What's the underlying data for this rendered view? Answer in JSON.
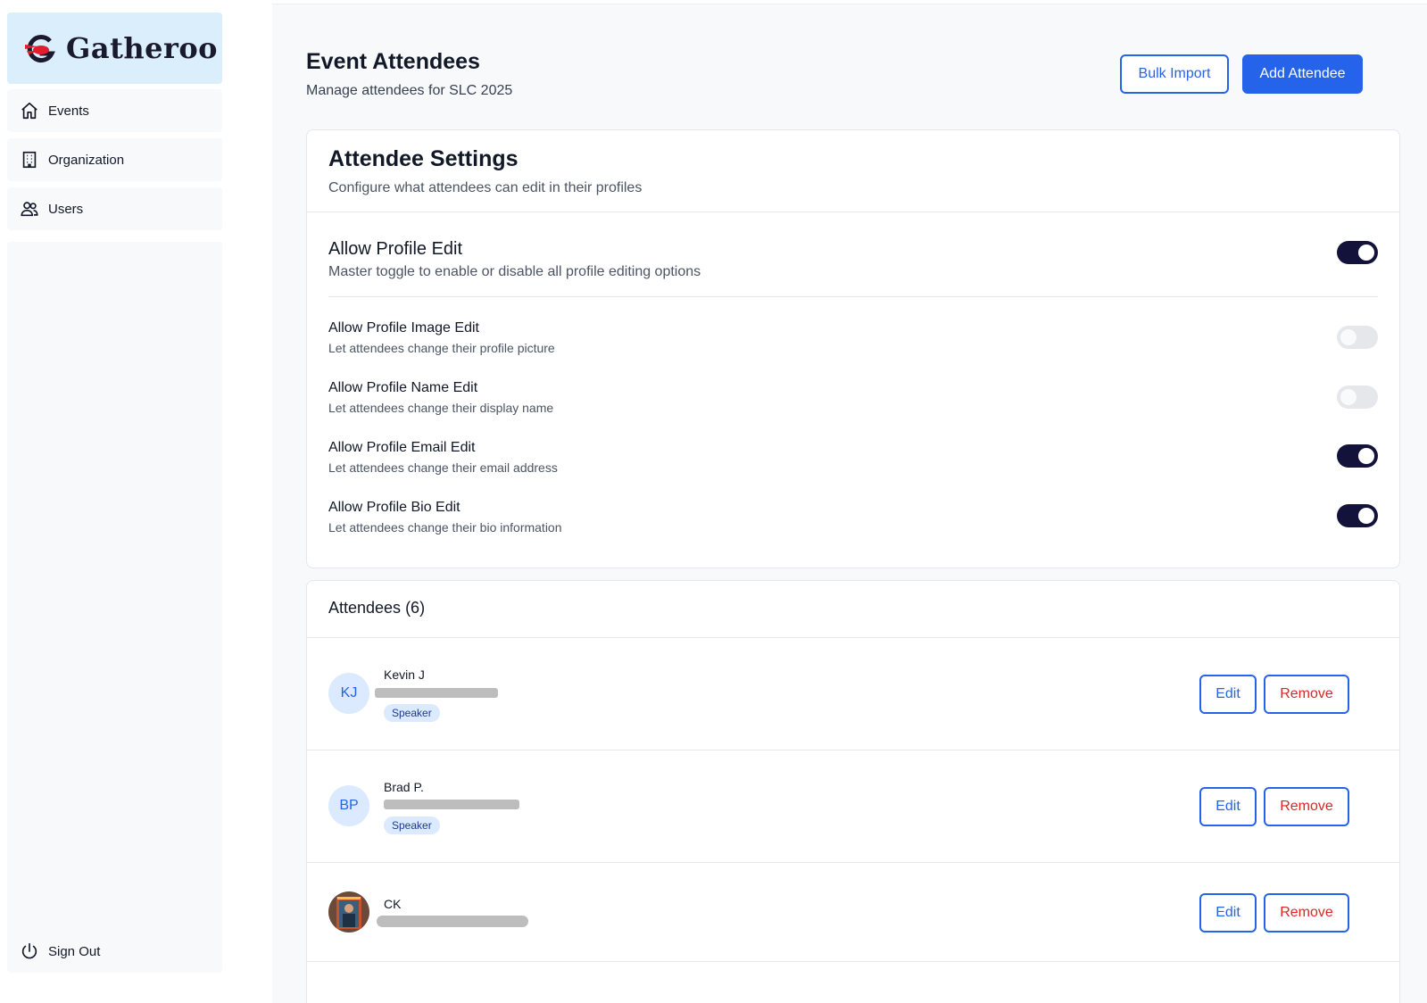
{
  "brand": {
    "name": "Gatheroo",
    "logo_icon": "gatheroo-logo-icon",
    "accent": "#2563eb",
    "toggle_on": "#13123a"
  },
  "sidebar": {
    "items": [
      {
        "label": "Events",
        "icon": "home-icon"
      },
      {
        "label": "Organization",
        "icon": "building-icon"
      },
      {
        "label": "Users",
        "icon": "users-icon"
      }
    ],
    "sign_out": {
      "label": "Sign Out",
      "icon": "power-icon"
    }
  },
  "header": {
    "title": "Event Attendees",
    "subtitle": "Manage attendees for SLC 2025",
    "bulk_import_label": "Bulk Import",
    "add_attendee_label": "Add Attendee"
  },
  "settings": {
    "title": "Attendee Settings",
    "subtitle": "Configure what attendees can edit in their profiles",
    "master": {
      "label": "Allow Profile Edit",
      "desc": "Master toggle to enable or disable all profile editing options",
      "on": true
    },
    "options": [
      {
        "label": "Allow Profile Image Edit",
        "desc": "Let attendees change their profile picture",
        "on": false
      },
      {
        "label": "Allow Profile Name Edit",
        "desc": "Let attendees change their display name",
        "on": false
      },
      {
        "label": "Allow Profile Email Edit",
        "desc": "Let attendees change their email address",
        "on": true
      },
      {
        "label": "Allow Profile Bio Edit",
        "desc": "Let attendees change their bio information",
        "on": true
      }
    ]
  },
  "attendees": {
    "title": "Attendees (6)",
    "edit_label": "Edit",
    "remove_label": "Remove",
    "rows": [
      {
        "initials": "KJ",
        "name": "Kevin J",
        "badge": "Speaker"
      },
      {
        "initials": "BP",
        "name": "Brad P.",
        "badge": "Speaker"
      },
      {
        "initials": "",
        "name": "CK",
        "badge": ""
      }
    ]
  }
}
